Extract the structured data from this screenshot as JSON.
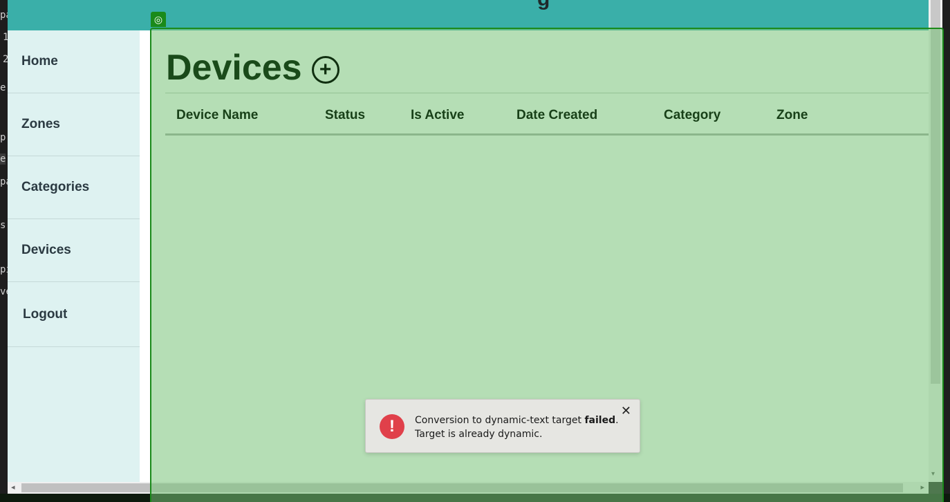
{
  "editor_fragments": [
    "pa",
    "1",
    "2",
    "e",
    "p",
    "e",
    "pa",
    "s",
    "pis",
    "ve"
  ],
  "topbar": {
    "title_fragment": "g"
  },
  "sidebar": {
    "items": [
      {
        "label": "Home"
      },
      {
        "label": "Zones"
      },
      {
        "label": "Categories"
      },
      {
        "label": "Devices"
      },
      {
        "label": "Logout"
      }
    ]
  },
  "page": {
    "title": "Devices",
    "add_symbol": "+",
    "columns": [
      "Device Name",
      "Status",
      "Is Active",
      "Date Created",
      "Category",
      "Zone"
    ]
  },
  "overlay": {
    "handle_symbol": "◎",
    "color": "#1a8a1a"
  },
  "toast": {
    "icon": "!",
    "message_before": "Conversion to dynamic-text target ",
    "message_bold": "failed",
    "message_after": ".",
    "message_line2": "Target is already dynamic.",
    "close_symbol": "✕",
    "accent_color": "#e0404a"
  },
  "scrollbars": {
    "down_arrow": "▾",
    "left_arrow": "◂",
    "right_arrow": "▸"
  }
}
